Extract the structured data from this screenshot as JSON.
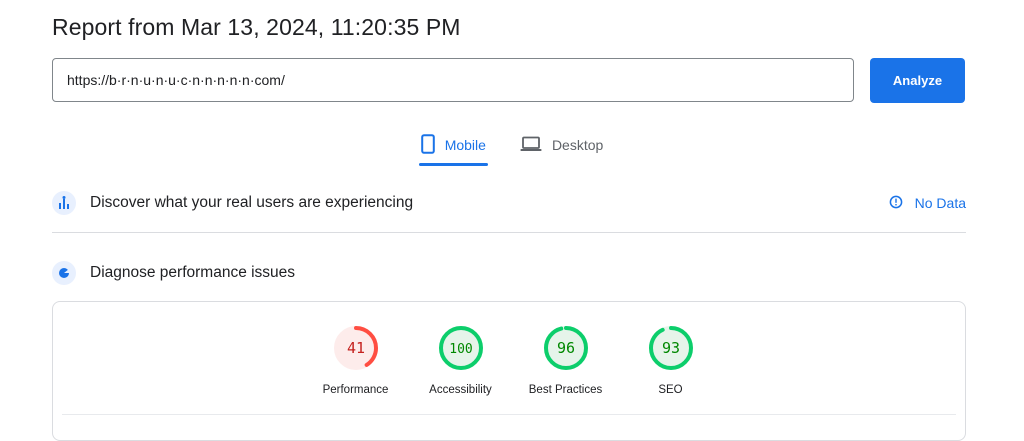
{
  "report": {
    "title": "Report from Mar 13, 2024, 11:20:35 PM"
  },
  "url_input": {
    "value": "https://b·r·n·u·n·u·c·n·n·n·n·n·com/"
  },
  "analyze_label": "Analyze",
  "tabs": [
    {
      "label": "Mobile",
      "icon": "mobile-phone-icon",
      "active": true
    },
    {
      "label": "Desktop",
      "icon": "laptop-icon",
      "active": false
    }
  ],
  "sections": {
    "real_users": {
      "label": "Discover what your real users are experiencing",
      "status": "No Data"
    },
    "diagnose": {
      "label": "Diagnose performance issues"
    }
  },
  "scores": [
    {
      "value": 41,
      "label": "Performance",
      "status": "fail"
    },
    {
      "value": 100,
      "label": "Accessibility",
      "status": "pass"
    },
    {
      "value": 96,
      "label": "Best Practices",
      "status": "pass"
    },
    {
      "value": 93,
      "label": "SEO",
      "status": "pass"
    }
  ],
  "colors": {
    "accent": "#1a73e8",
    "fail_stroke": "#ff4e42",
    "fail_fill": "#fdeceb",
    "fail_text": "#c5221f",
    "pass_stroke": "#0cce6b",
    "pass_fill": "#e6f4ea",
    "pass_text": "#008800"
  }
}
